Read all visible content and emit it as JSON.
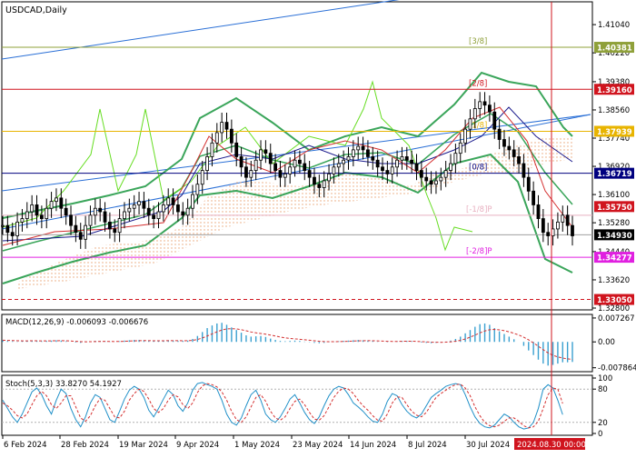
{
  "chart_data": {
    "type": "line",
    "symbol": "USDCAD,Daily",
    "price_axis": {
      "min": 1.328,
      "max": 1.4165,
      "ticks": [
        "1.41040",
        "1.40220",
        "1.39380",
        "1.38560",
        "1.37740",
        "1.36920",
        "1.36100",
        "1.35280",
        "1.34440",
        "1.33620",
        "1.32800"
      ]
    },
    "price_tags": [
      {
        "value": "1.40381",
        "price": 1.40381,
        "bg": "#8fa03a",
        "fg": "#ffffff"
      },
      {
        "value": "1.39160",
        "price": 1.3916,
        "bg": "#d0141e",
        "fg": "#ffffff"
      },
      {
        "value": "1.37939",
        "price": 1.37939,
        "bg": "#e8b400",
        "fg": "#ffffff"
      },
      {
        "value": "1.36719",
        "price": 1.36719,
        "bg": "#00007f",
        "fg": "#ffffff"
      },
      {
        "value": "1.35750",
        "price": 1.3575,
        "bg": "#d0141e",
        "fg": "#ffffff"
      },
      {
        "value": "1.34930",
        "price": 1.3493,
        "bg": "#000000",
        "fg": "#ffffff"
      },
      {
        "value": "1.34277",
        "price": 1.34277,
        "bg": "#e020e0",
        "fg": "#ffffff"
      },
      {
        "value": "1.33050",
        "price": 1.3305,
        "bg": "#d0141e",
        "fg": "#ffffff"
      }
    ],
    "murrey_levels": [
      {
        "label": "[3/8]",
        "price": 1.40381,
        "color": "#8fa03a"
      },
      {
        "label": "[2/8]",
        "price": 1.3916,
        "color": "#d0141e"
      },
      {
        "label": "[1/8]",
        "price": 1.37939,
        "color": "#e8b400"
      },
      {
        "label": "[0/8]",
        "price": 1.36719,
        "color": "#00007f"
      },
      {
        "label": "[-1/8]P",
        "price": 1.35498,
        "color": "#e8b0c0"
      },
      {
        "label": "[-2/8]P",
        "price": 1.34277,
        "color": "#e020e0"
      }
    ],
    "dashed_level": {
      "price": 1.3305,
      "color": "#d0141e"
    },
    "grey_level": {
      "price": 1.3493,
      "color": "#a0a0a0"
    },
    "x_labels": [
      "6 Feb 2024",
      "28 Feb 2024",
      "19 Mar 2024",
      "9 Apr 2024",
      "1 May 2024",
      "23 May 2024",
      "14 Jun 2024",
      "8 Jul 2024",
      "30 Jul 2024"
    ],
    "cursor_time": "2024.08.30 00:00",
    "close_series": [
      1.352,
      1.35,
      1.349,
      1.353,
      1.354,
      1.356,
      1.358,
      1.355,
      1.354,
      1.357,
      1.359,
      1.36,
      1.357,
      1.355,
      1.352,
      1.35,
      1.348,
      1.352,
      1.355,
      1.357,
      1.356,
      1.353,
      1.351,
      1.35,
      1.354,
      1.356,
      1.357,
      1.358,
      1.359,
      1.357,
      1.355,
      1.354,
      1.356,
      1.358,
      1.36,
      1.358,
      1.356,
      1.355,
      1.357,
      1.361,
      1.364,
      1.368,
      1.372,
      1.376,
      1.379,
      1.382,
      1.38,
      1.376,
      1.372,
      1.369,
      1.366,
      1.368,
      1.371,
      1.374,
      1.373,
      1.37,
      1.368,
      1.366,
      1.367,
      1.369,
      1.371,
      1.37,
      1.368,
      1.366,
      1.364,
      1.363,
      1.365,
      1.367,
      1.369,
      1.37,
      1.371,
      1.372,
      1.374,
      1.375,
      1.374,
      1.372,
      1.371,
      1.369,
      1.368,
      1.367,
      1.369,
      1.371,
      1.372,
      1.371,
      1.37,
      1.368,
      1.366,
      1.365,
      1.364,
      1.365,
      1.366,
      1.368,
      1.37,
      1.373,
      1.376,
      1.38,
      1.383,
      1.386,
      1.388,
      1.387,
      1.385,
      1.38,
      1.377,
      1.375,
      1.374,
      1.372,
      1.37,
      1.366,
      1.362,
      1.358,
      1.354,
      1.35,
      1.349,
      1.351,
      1.353,
      1.355,
      1.352,
      1.349
    ],
    "macd": {
      "label": "MACD(12,26,9) -0.006093 -0.006676",
      "min": -0.0085,
      "max": 0.0078,
      "ticks": [
        "0.007267",
        "0.00",
        "-0.007864"
      ],
      "hist": [
        0.0005,
        0.0003,
        0.0002,
        0.0001,
        0.0002,
        0.0003,
        0.0004,
        0.0003,
        0.0002,
        0.0003,
        0.0004,
        0.0005,
        0.0004,
        0.0002,
        0.0,
        -0.0002,
        -0.0003,
        -0.0001,
        0.0001,
        0.0003,
        0.0003,
        0.0002,
        0.0001,
        0.0,
        0.0002,
        0.0004,
        0.0005,
        0.0006,
        0.0006,
        0.0005,
        0.0003,
        0.0002,
        0.0003,
        0.0004,
        0.0005,
        0.0004,
        0.0003,
        0.0003,
        0.0004,
        0.0009,
        0.0018,
        0.003,
        0.0042,
        0.005,
        0.0056,
        0.0058,
        0.0052,
        0.0044,
        0.0036,
        0.0028,
        0.002,
        0.0016,
        0.0017,
        0.0018,
        0.0015,
        0.001,
        0.0006,
        0.0003,
        0.0002,
        0.0003,
        0.0004,
        0.0003,
        0.0001,
        -0.0001,
        -0.0003,
        -0.0004,
        -0.0003,
        -0.0001,
        0.0001,
        0.0002,
        0.0003,
        0.0004,
        0.0005,
        0.0006,
        0.0005,
        0.0004,
        0.0003,
        0.0001,
        0.0,
        -0.0001,
        0.0,
        0.0002,
        0.0003,
        0.0003,
        0.0002,
        0.0,
        -0.0002,
        -0.0003,
        -0.0004,
        -0.0003,
        -0.0002,
        0.0001,
        0.0004,
        0.0009,
        0.0016,
        0.0026,
        0.0036,
        0.0046,
        0.0054,
        0.0056,
        0.0052,
        0.0042,
        0.0032,
        0.0024,
        0.0016,
        0.0008,
        0.0,
        -0.0012,
        -0.0026,
        -0.004,
        -0.0054,
        -0.0066,
        -0.0072,
        -0.007,
        -0.0066,
        -0.0062,
        -0.0062,
        -0.0061
      ]
    },
    "stoch": {
      "label": "Stoch(5,3,3) 33.8270 54.1927",
      "min": 0,
      "max": 100,
      "ticks": [
        "100",
        "80",
        "20",
        "0"
      ],
      "main": [
        60,
        45,
        30,
        20,
        35,
        55,
        75,
        82,
        70,
        50,
        35,
        60,
        80,
        72,
        45,
        25,
        12,
        30,
        55,
        70,
        65,
        45,
        25,
        20,
        40,
        62,
        78,
        85,
        80,
        65,
        42,
        30,
        45,
        62,
        78,
        70,
        50,
        40,
        55,
        78,
        90,
        92,
        88,
        85,
        80,
        60,
        35,
        20,
        15,
        28,
        50,
        70,
        78,
        60,
        35,
        25,
        20,
        30,
        45,
        62,
        70,
        55,
        38,
        25,
        18,
        30,
        50,
        68,
        80,
        85,
        82,
        70,
        55,
        48,
        40,
        30,
        22,
        20,
        35,
        58,
        72,
        68,
        52,
        40,
        32,
        28,
        35,
        50,
        65,
        72,
        78,
        85,
        88,
        90,
        88,
        70,
        48,
        30,
        18,
        12,
        10,
        15,
        25,
        35,
        30,
        20,
        12,
        8,
        10,
        20,
        45,
        80,
        88,
        82,
        60,
        34
      ],
      "signal": [
        55,
        50,
        42,
        32,
        28,
        35,
        52,
        68,
        76,
        68,
        52,
        45,
        55,
        68,
        68,
        48,
        28,
        22,
        32,
        50,
        63,
        60,
        45,
        30,
        28,
        40,
        60,
        72,
        80,
        76,
        62,
        45,
        38,
        45,
        60,
        70,
        66,
        52,
        45,
        55,
        74,
        86,
        90,
        88,
        84,
        75,
        60,
        40,
        25,
        20,
        30,
        48,
        65,
        70,
        58,
        40,
        28,
        24,
        30,
        45,
        58,
        62,
        52,
        38,
        26,
        24,
        32,
        48,
        65,
        76,
        82,
        80,
        72,
        60,
        50,
        42,
        32,
        24,
        22,
        35,
        55,
        66,
        65,
        52,
        40,
        33,
        30,
        38,
        52,
        65,
        72,
        78,
        84,
        88,
        89,
        82,
        68,
        48,
        32,
        20,
        14,
        12,
        15,
        22,
        28,
        28,
        22,
        14,
        10,
        12,
        22,
        45,
        70,
        82,
        80,
        54
      ]
    }
  }
}
